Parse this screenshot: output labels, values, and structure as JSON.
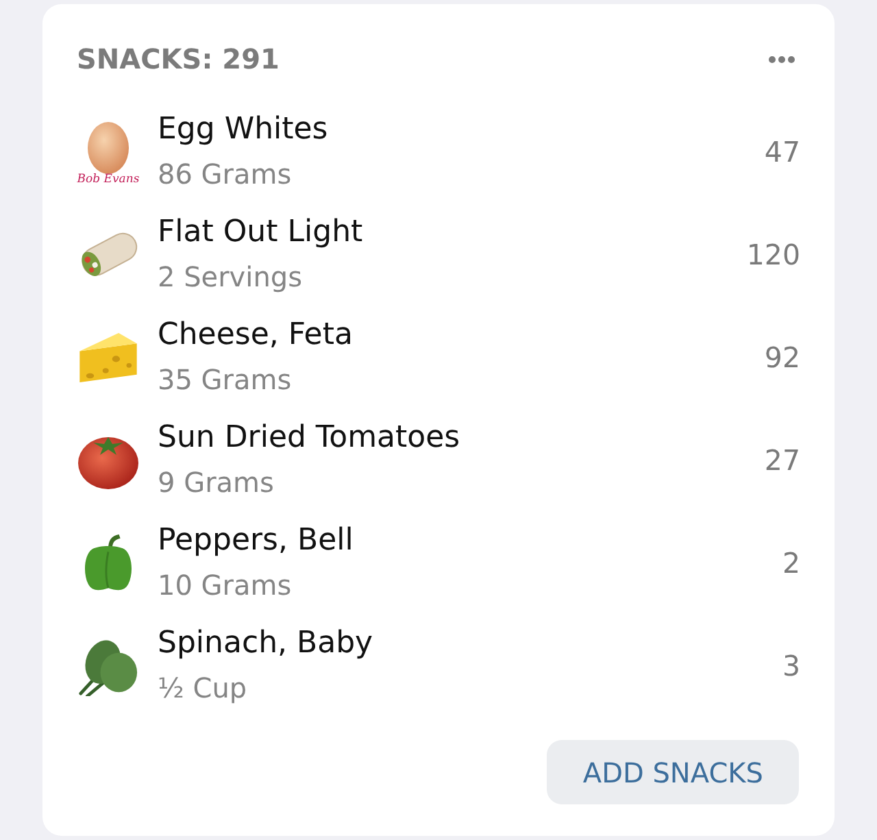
{
  "header": {
    "title": "SNACKS: 291"
  },
  "items": [
    {
      "kind": "egg",
      "name": "Egg Whites",
      "amount": "86 Grams",
      "calories": "47",
      "brand": "Bob Evans"
    },
    {
      "kind": "wrap",
      "name": "Flat Out Light",
      "amount": "2 Servings",
      "calories": "120"
    },
    {
      "kind": "cheese",
      "name": "Cheese, Feta",
      "amount": "35 Grams",
      "calories": "92"
    },
    {
      "kind": "tomato",
      "name": "Sun Dried Tomatoes",
      "amount": "9 Grams",
      "calories": "27"
    },
    {
      "kind": "pepper",
      "name": "Peppers, Bell",
      "amount": "10 Grams",
      "calories": "2"
    },
    {
      "kind": "spinach",
      "name": "Spinach, Baby",
      "amount": "½ Cup",
      "calories": "3"
    }
  ],
  "add_button": {
    "label": "ADD SNACKS"
  }
}
